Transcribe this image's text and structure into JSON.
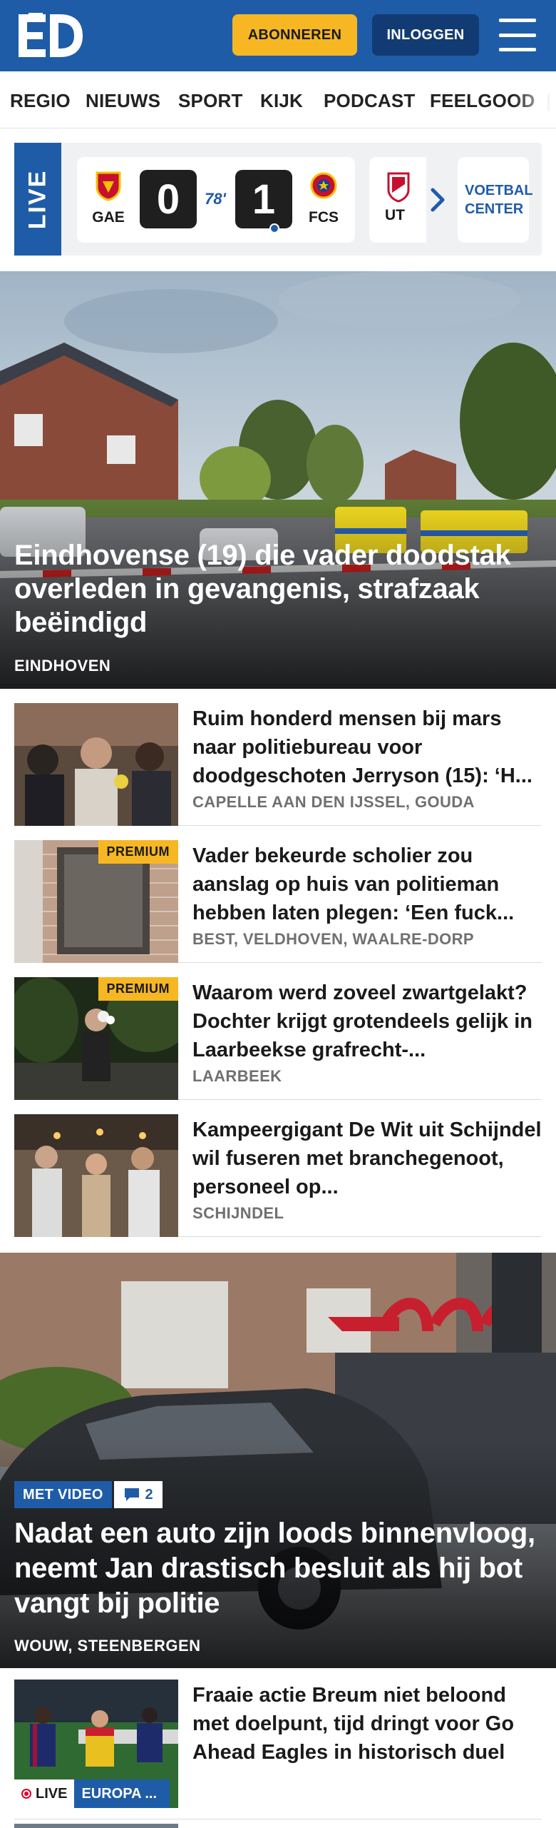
{
  "header": {
    "logo_text": "ED",
    "subscribe_label": "ABONNEREN",
    "login_label": "INLOGGEN"
  },
  "nav": {
    "items": [
      "REGIO",
      "NIEUWS",
      "SPORT",
      "KIJK",
      "PODCAST",
      "FEELGOOD"
    ]
  },
  "live_scores": {
    "live_label": "LIVE",
    "match": {
      "home": "GAE",
      "away": "FCS",
      "home_score": "0",
      "away_score": "1",
      "minute": "78'"
    },
    "next_match_home": "UT",
    "football_center_label": "VOETBAL CENTER"
  },
  "top_story": {
    "title": "Eindhovense (19) die vader doodstak overleden in gevangenis, strafzaak beëindigd",
    "location": "EINDHOVEN"
  },
  "articles": [
    {
      "title": "Ruim honderd mensen bij mars naar politiebureau voor doodgeschoten Jerryson (15): ‘H...",
      "location": "CAPELLE AAN DEN IJSSEL, GOUDA",
      "premium": ""
    },
    {
      "title": "Vader bekeurde scholier zou aanslag op huis van politieman hebben laten plegen: ‘Een fuck...",
      "location": "BEST, VELDHOVEN, WAALRE-DORP",
      "premium": "PREMIUM"
    },
    {
      "title": "Waarom werd zoveel zwartge­lakt? Dochter krijgt grotendeels gelijk in Laarbeekse grafrecht-...",
      "location": "LAARBEEK",
      "premium": "PREMIUM"
    },
    {
      "title": "Kampeergigant De Wit uit Schijndel wil fuseren met branchegenoot, personeel op...",
      "location": "SCHIJNDEL",
      "premium": ""
    }
  ],
  "second_story": {
    "video_label": "MET VIDEO",
    "comment_count": "2",
    "title": "Nadat een auto zijn loods binnen­vloog, neemt Jan drastisch besluit als hij bot vangt bij politie",
    "location": "WOUW, STEENBERGEN"
  },
  "live_article": {
    "title": "Fraaie actie Breum niet beloond met doelpunt, tijd dringt voor Go Ahead Eagles in historisch duel",
    "live_label": "LIVE",
    "category": "EUROPA ..."
  },
  "colors": {
    "brand_blue": "#1f5ca8",
    "accent_yellow": "#f6b723",
    "dark_navy": "#123b73"
  }
}
